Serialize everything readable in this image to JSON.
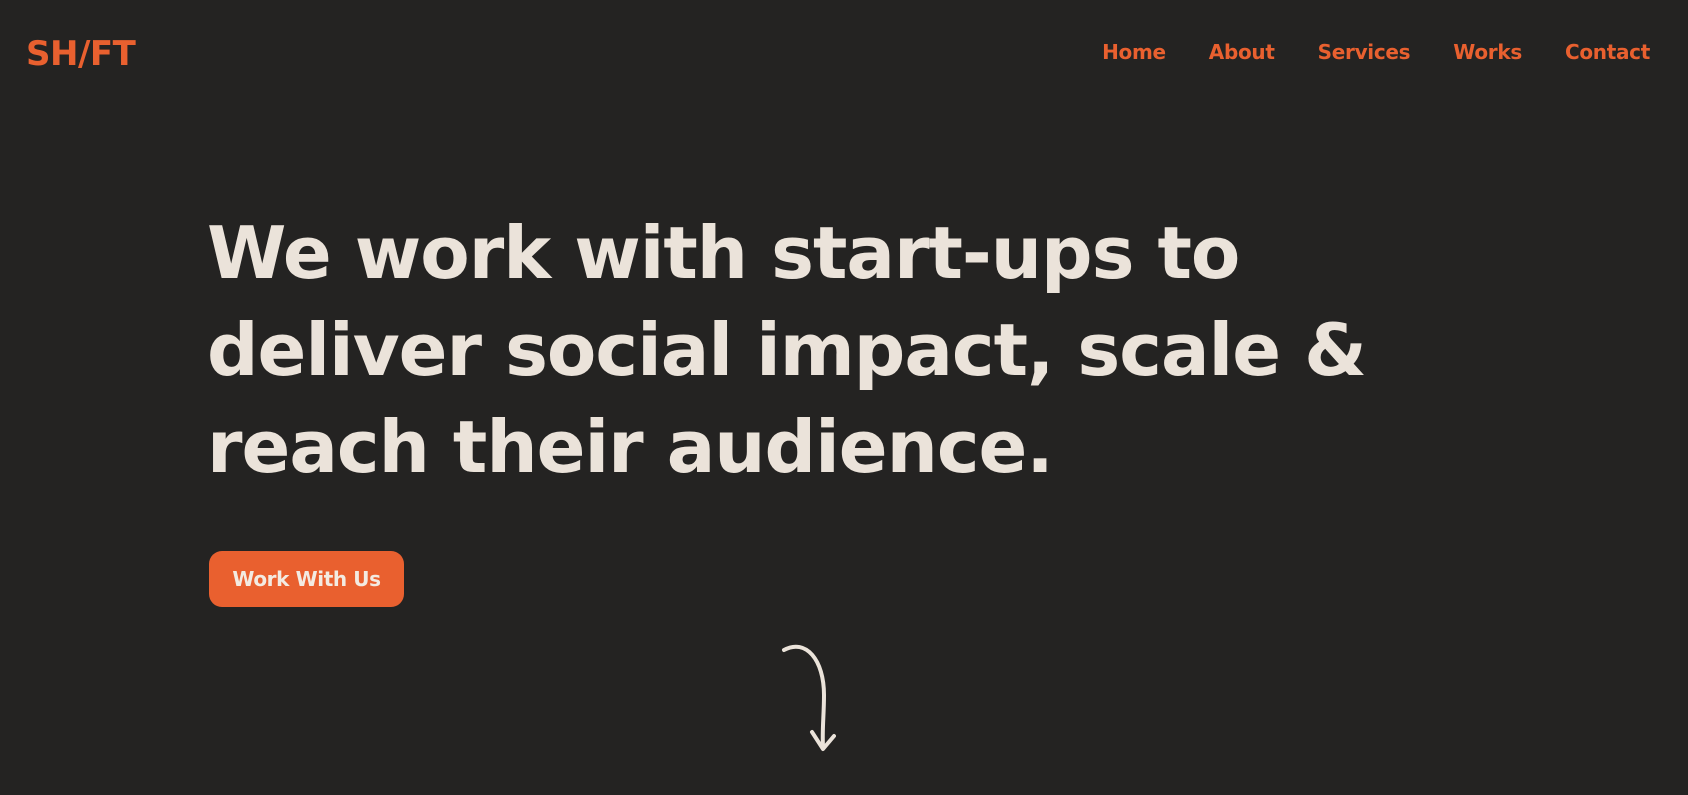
{
  "brand": {
    "logo_text": "SH/FT",
    "accent_color": "#e9602f",
    "background_color": "#242322",
    "text_color": "#ebe3da"
  },
  "nav": {
    "items": [
      {
        "label": "Home"
      },
      {
        "label": "About"
      },
      {
        "label": "Services"
      },
      {
        "label": "Works"
      },
      {
        "label": "Contact"
      }
    ]
  },
  "hero": {
    "heading": "We work with start-ups to deliver social impact, scale & reach their audience.",
    "cta_label": "Work With Us"
  },
  "icons": {
    "scroll_indicator": "curved-arrow-down-icon"
  }
}
